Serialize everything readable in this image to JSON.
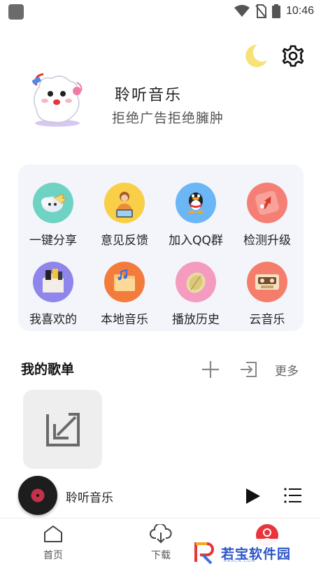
{
  "status_bar": {
    "time": "10:46"
  },
  "header": {
    "app_name": "聆听音乐",
    "slogan": "拒绝广告拒绝臃肿",
    "icons": [
      "moon-icon",
      "gear-icon"
    ]
  },
  "grid": {
    "items": [
      {
        "label": "一键分享",
        "icon": "share-icon",
        "color": "#6fd3c4"
      },
      {
        "label": "意见反馈",
        "icon": "feedback-icon",
        "color": "#f9cf47"
      },
      {
        "label": "加入QQ群",
        "icon": "qq-icon",
        "color": "#6bb6f5"
      },
      {
        "label": "检测升级",
        "icon": "upgrade-icon",
        "color": "#f57f74"
      },
      {
        "label": "我喜欢的",
        "icon": "favorite-icon",
        "color": "#8f85ea"
      },
      {
        "label": "本地音乐",
        "icon": "local-music-icon",
        "color": "#f37b3c"
      },
      {
        "label": "播放历史",
        "icon": "history-icon",
        "color": "#f59bbf"
      },
      {
        "label": "云音乐",
        "icon": "cloud-music-icon",
        "color": "#f47d6c"
      }
    ]
  },
  "playlists": {
    "title": "我的歌单",
    "more_label": "更多"
  },
  "player": {
    "title": "聆听音乐"
  },
  "nav": {
    "items": [
      {
        "label": "首页",
        "icon": "home-icon"
      },
      {
        "label": "下载",
        "icon": "cloud-download-icon"
      },
      {
        "label": "",
        "icon": "profile-icon"
      }
    ]
  },
  "watermark": {
    "text": "若宝软件园",
    "sub": "RBSCN.COM"
  },
  "colors": {
    "accent": "#e8353c",
    "grid_bg": "#f3f5fb",
    "brand_blue": "#2b54c8"
  }
}
